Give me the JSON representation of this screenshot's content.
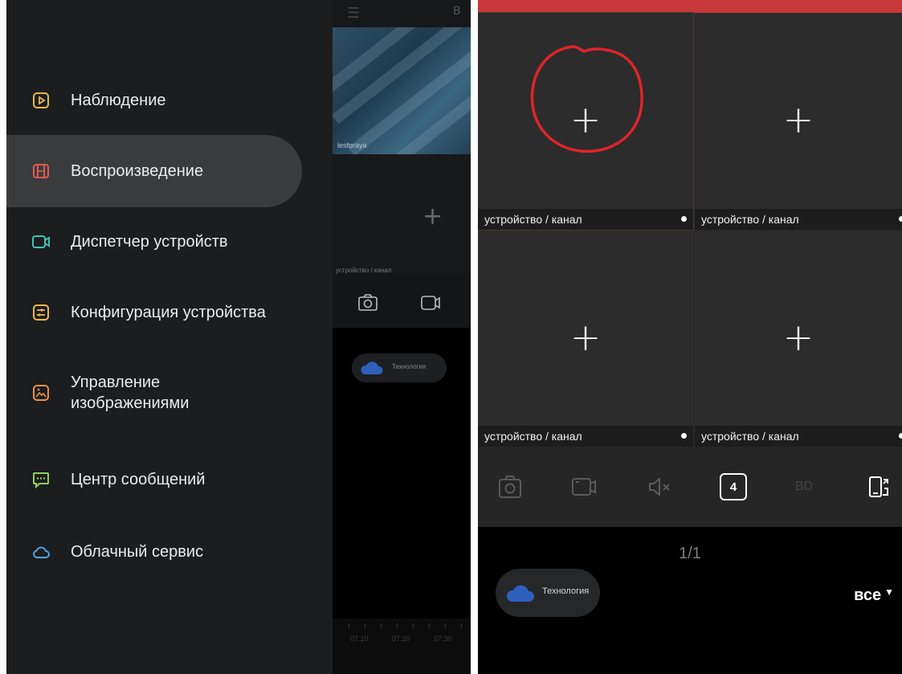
{
  "colors": {
    "accent_red": "#c8383a",
    "annotation_red": "#e0242a",
    "icon_yellow": "#e8b84a",
    "icon_red": "#e05a52",
    "icon_teal": "#3dc4b4",
    "icon_orange": "#e8914a",
    "icon_green": "#8ed05a",
    "icon_blue": "#4aa6e8"
  },
  "left": {
    "menu": [
      {
        "label": "Наблюдение",
        "icon": "play-square-icon"
      },
      {
        "label": "Воспроизведение",
        "icon": "film-icon",
        "active": true
      },
      {
        "label": "Диспетчер устройств",
        "icon": "camera-icon"
      },
      {
        "label": "Конфигурация устройства",
        "icon": "sliders-icon"
      },
      {
        "label": "Управление изображениями",
        "icon": "image-icon"
      },
      {
        "label": "Центр сообщений",
        "icon": "message-icon"
      },
      {
        "label": "Облачный сервис",
        "icon": "cloud-icon"
      }
    ],
    "behind": {
      "header_letter": "В",
      "thumbnail_label": "lesforaya",
      "cell_label": "устройство / канал",
      "chip_label": "Технология",
      "times": [
        "07:10",
        "07:20",
        "07:30"
      ]
    }
  },
  "right": {
    "cells": [
      {
        "label": "устройство / канал"
      },
      {
        "label": "устройство / канал"
      },
      {
        "label": "устройство / канал"
      },
      {
        "label": "устройство / канал"
      }
    ],
    "toolbar": {
      "layout_value": "4",
      "quality_label": "BD"
    },
    "page_indicator": "1/1",
    "chip_label": "Технология",
    "filter_label": "все"
  }
}
